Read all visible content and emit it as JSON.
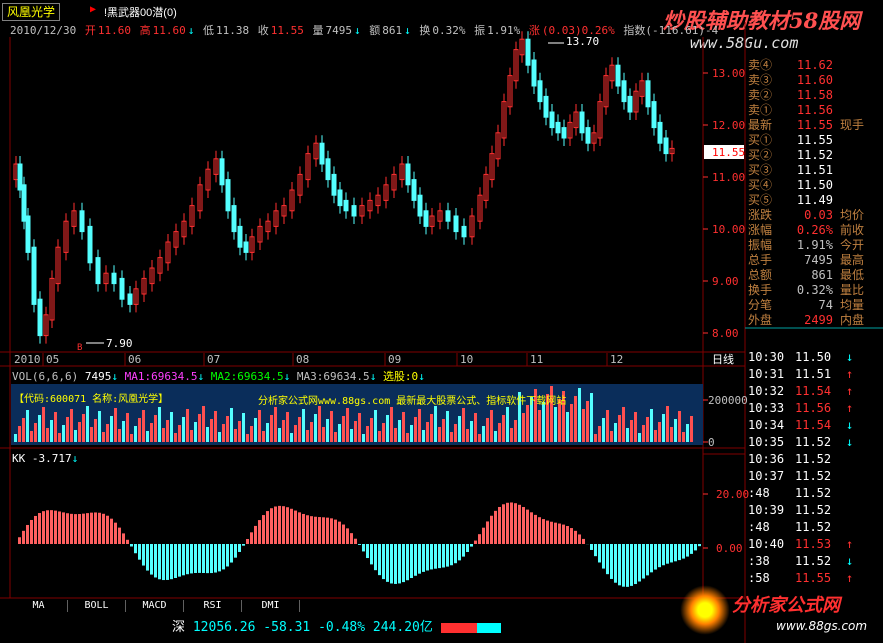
{
  "title": "风凰光学",
  "title_tag": "!黑武器00潜(0)",
  "info": {
    "date": "2010/12/30",
    "open_label": "开",
    "open": "11.60",
    "high_label": "高",
    "high": "11.60",
    "low_label": "低",
    "low": "11.38",
    "close_label": "收",
    "close": "11.55",
    "vol_label": "量",
    "vol": "7495",
    "amount_label": "额",
    "amount": "861",
    "turnover_label": "换",
    "turnover": "0.32%",
    "amp_label": "振",
    "amp": "1.91%",
    "chg_label": "涨",
    "chg": "(0.03)0.26%",
    "index_text": "指数(-116.61)-4"
  },
  "watermark_top": "炒股辅助教材58股网",
  "watermark_url": "www.58Gu.com",
  "price_axis": [
    "13.00",
    "12.00",
    "11.00",
    "10.00",
    "9.00",
    "8.00"
  ],
  "price_high_label": "13.70",
  "price_low_label": "7.90",
  "current_price_tag": "11.55",
  "month_axis": [
    "2010",
    "05",
    "06",
    "07",
    "08",
    "09",
    "10",
    "11",
    "12"
  ],
  "period_label": "日线",
  "vol_header": {
    "label": "VOL(6,6,6)",
    "vol": "7495",
    "ma1": "MA1:69634.5",
    "ma2": "MA2:69634.5",
    "ma3": "MA3:69634.5",
    "pick": "选股:0"
  },
  "vol_banner": "【代码:600071 名称:风凰光学】",
  "vol_banner2": "分析家公式网www.88gs.com 最新最大股票公式、指标软件下载网站",
  "vol_axis": [
    "200000",
    "0"
  ],
  "kk_header": "KK -3.717",
  "kk_axis": [
    "20.00",
    "0.00"
  ],
  "quotes": [
    {
      "label": "卖④",
      "value": "11.62",
      "color": "#ff3030"
    },
    {
      "label": "卖③",
      "value": "11.60",
      "color": "#ff3030"
    },
    {
      "label": "卖②",
      "value": "11.58",
      "color": "#ff3030"
    },
    {
      "label": "卖①",
      "value": "11.56",
      "color": "#ff3030"
    },
    {
      "label": "最新",
      "value": "11.55",
      "color": "#ff3030",
      "extra": "现手"
    },
    {
      "label": "买①",
      "value": "11.55",
      "color": "#ffffff"
    },
    {
      "label": "买②",
      "value": "11.52",
      "color": "#ffffff"
    },
    {
      "label": "买③",
      "value": "11.51",
      "color": "#ffffff"
    },
    {
      "label": "买④",
      "value": "11.50",
      "color": "#ffffff"
    },
    {
      "label": "买⑤",
      "value": "11.49",
      "color": "#ffffff"
    },
    {
      "label": "涨跌",
      "value": "0.03",
      "color": "#ff3030",
      "extra": "均价"
    },
    {
      "label": "涨幅",
      "value": "0.26%",
      "color": "#ff3030",
      "extra": "前收"
    },
    {
      "label": "振幅",
      "value": "1.91%",
      "color": "#c0c0c0",
      "extra": "今开"
    },
    {
      "label": "总手",
      "value": "7495",
      "color": "#c0c0c0",
      "extra": "最高"
    },
    {
      "label": "总额",
      "value": "861",
      "color": "#c0c0c0",
      "extra": "最低"
    },
    {
      "label": "换手",
      "value": "0.32%",
      "color": "#c0c0c0",
      "extra": "量比"
    },
    {
      "label": "分笔",
      "value": "74",
      "color": "#c0c0c0",
      "extra": "均量"
    },
    {
      "label": "外盘",
      "value": "2499",
      "color": "#ff3030",
      "extra": "内盘"
    }
  ],
  "ticks": [
    {
      "time": "10:30",
      "price": "11.50",
      "color": "#ffffff",
      "arrow": "↓",
      "acolor": "#00ffff"
    },
    {
      "time": "10:31",
      "price": "11.51",
      "color": "#ffffff",
      "arrow": "↑",
      "acolor": "#ff3030"
    },
    {
      "time": "10:32",
      "price": "11.54",
      "color": "#ff3030",
      "arrow": "↑",
      "acolor": "#ff3030"
    },
    {
      "time": "10:33",
      "price": "11.56",
      "color": "#ff3030",
      "arrow": "↑",
      "acolor": "#ff3030"
    },
    {
      "time": "10:34",
      "price": "11.54",
      "color": "#ff3030",
      "arrow": "↓",
      "acolor": "#00ffff"
    },
    {
      "time": "10:35",
      "price": "11.52",
      "color": "#ffffff",
      "arrow": "↓",
      "acolor": "#00ffff"
    },
    {
      "time": "10:36",
      "price": "11.52",
      "color": "#ffffff",
      "arrow": "",
      "acolor": "#ffffff"
    },
    {
      "time": "10:37",
      "price": "11.52",
      "color": "#ffffff",
      "arrow": "",
      "acolor": "#ffffff"
    },
    {
      "time": ":48",
      "price": "11.52",
      "color": "#ffffff",
      "arrow": "",
      "acolor": "#ffffff"
    },
    {
      "time": "10:39",
      "price": "11.52",
      "color": "#ffffff",
      "arrow": "",
      "acolor": "#ffffff"
    },
    {
      "time": ":48",
      "price": "11.52",
      "color": "#ffffff",
      "arrow": "",
      "acolor": "#ffffff"
    },
    {
      "time": "10:40",
      "price": "11.53",
      "color": "#ff3030",
      "arrow": "↑",
      "acolor": "#ff3030"
    },
    {
      "time": ":38",
      "price": "11.52",
      "color": "#ffffff",
      "arrow": "↓",
      "acolor": "#00ffff"
    },
    {
      "time": ":58",
      "price": "11.55",
      "color": "#ff3030",
      "arrow": "↑",
      "acolor": "#ff3030"
    }
  ],
  "tabs": [
    "MA",
    "BOLL",
    "MACD",
    "RSI",
    "DMI"
  ],
  "status": {
    "market": "深",
    "index": "12056.26",
    "change": "-58.31",
    "pct": "-0.48%",
    "amount": "244.20亿"
  },
  "logo_text": "分析家公式网",
  "logo_url": "www.88gs.com"
}
